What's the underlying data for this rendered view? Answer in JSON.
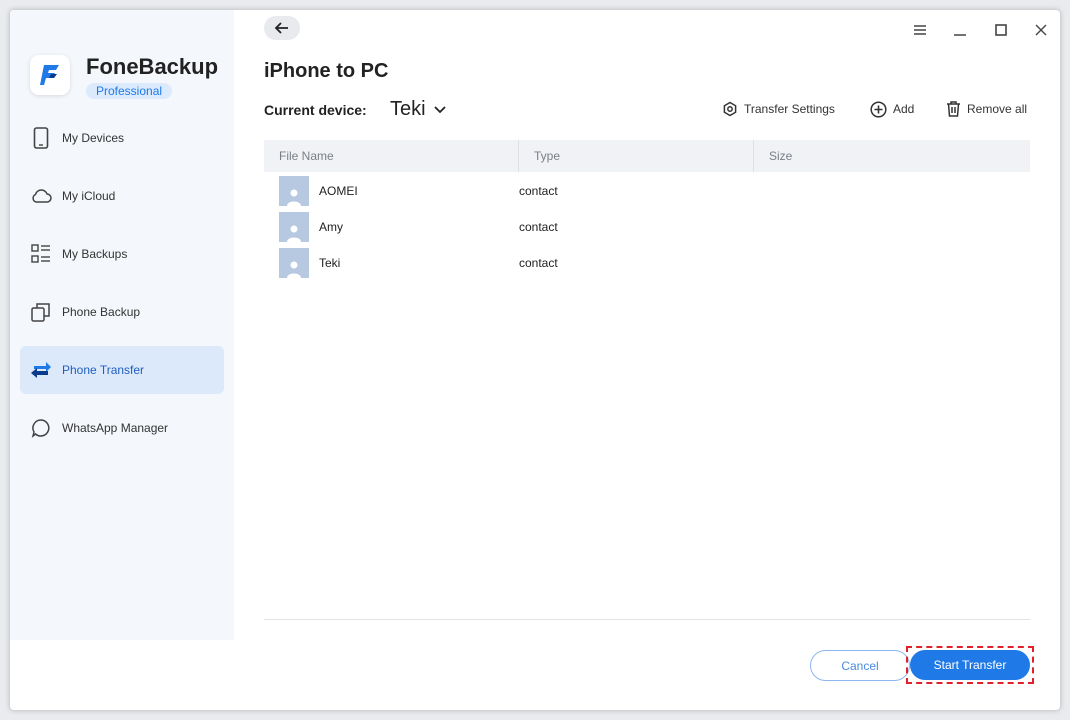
{
  "app": {
    "name": "FoneBackup",
    "edition": "Professional"
  },
  "sidebar": {
    "items": [
      {
        "label": "My Devices",
        "icon": "phone-icon"
      },
      {
        "label": "My iCloud",
        "icon": "cloud-icon"
      },
      {
        "label": "My Backups",
        "icon": "list-icon"
      },
      {
        "label": "Phone Backup",
        "icon": "copy-icon"
      },
      {
        "label": "Phone Transfer",
        "icon": "transfer-icon",
        "active": true
      },
      {
        "label": "WhatsApp Manager",
        "icon": "chat-icon"
      }
    ]
  },
  "main": {
    "title": "iPhone to PC",
    "device_label": "Current device:",
    "device_value": "Teki",
    "toolbar": {
      "transfer_settings": "Transfer Settings",
      "add": "Add",
      "remove_all": "Remove all"
    },
    "table": {
      "columns": [
        "File Name",
        "Type",
        "Size"
      ],
      "rows": [
        {
          "name": "AOMEI",
          "type": "contact",
          "size": ""
        },
        {
          "name": "Amy",
          "type": "contact",
          "size": ""
        },
        {
          "name": "Teki",
          "type": "contact",
          "size": ""
        }
      ]
    },
    "buttons": {
      "cancel": "Cancel",
      "start": "Start Transfer"
    }
  },
  "colors": {
    "accent": "#1f7ae8",
    "highlight": "#e0202a",
    "sidebar_bg": "#f4f7fb"
  }
}
